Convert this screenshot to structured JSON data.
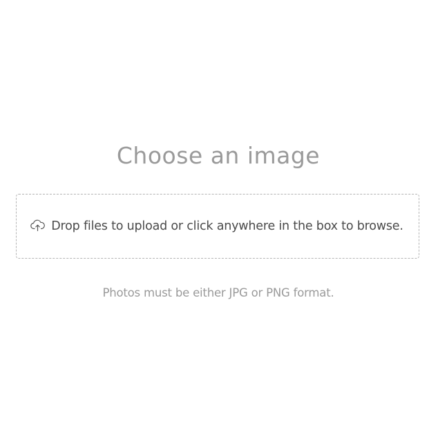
{
  "page": {
    "title": "Choose an image",
    "hint": "Photos must be either JPG or PNG format."
  },
  "dropzone": {
    "icon": "cloud-upload-icon",
    "label": "Drop files to upload or click anywhere in the box to browse."
  },
  "colors": {
    "title": "#9a9a9a",
    "text": "#4a4a4a",
    "hint": "#9a9a9a",
    "border": "#b3b3b3",
    "background": "#ffffff"
  }
}
